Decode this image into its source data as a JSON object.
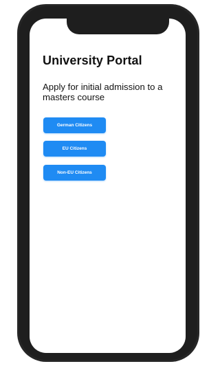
{
  "app": {
    "title": "University Portal",
    "subtitle": "Apply for initial admission to a masters course"
  },
  "buttons": [
    {
      "label": "German Citizens"
    },
    {
      "label": "EU Citizens"
    },
    {
      "label": "Non-EU Citizens"
    }
  ],
  "colors": {
    "accent": "#1f8bf3",
    "frame": "#262626",
    "screen": "#ffffff",
    "text": "#111111"
  }
}
